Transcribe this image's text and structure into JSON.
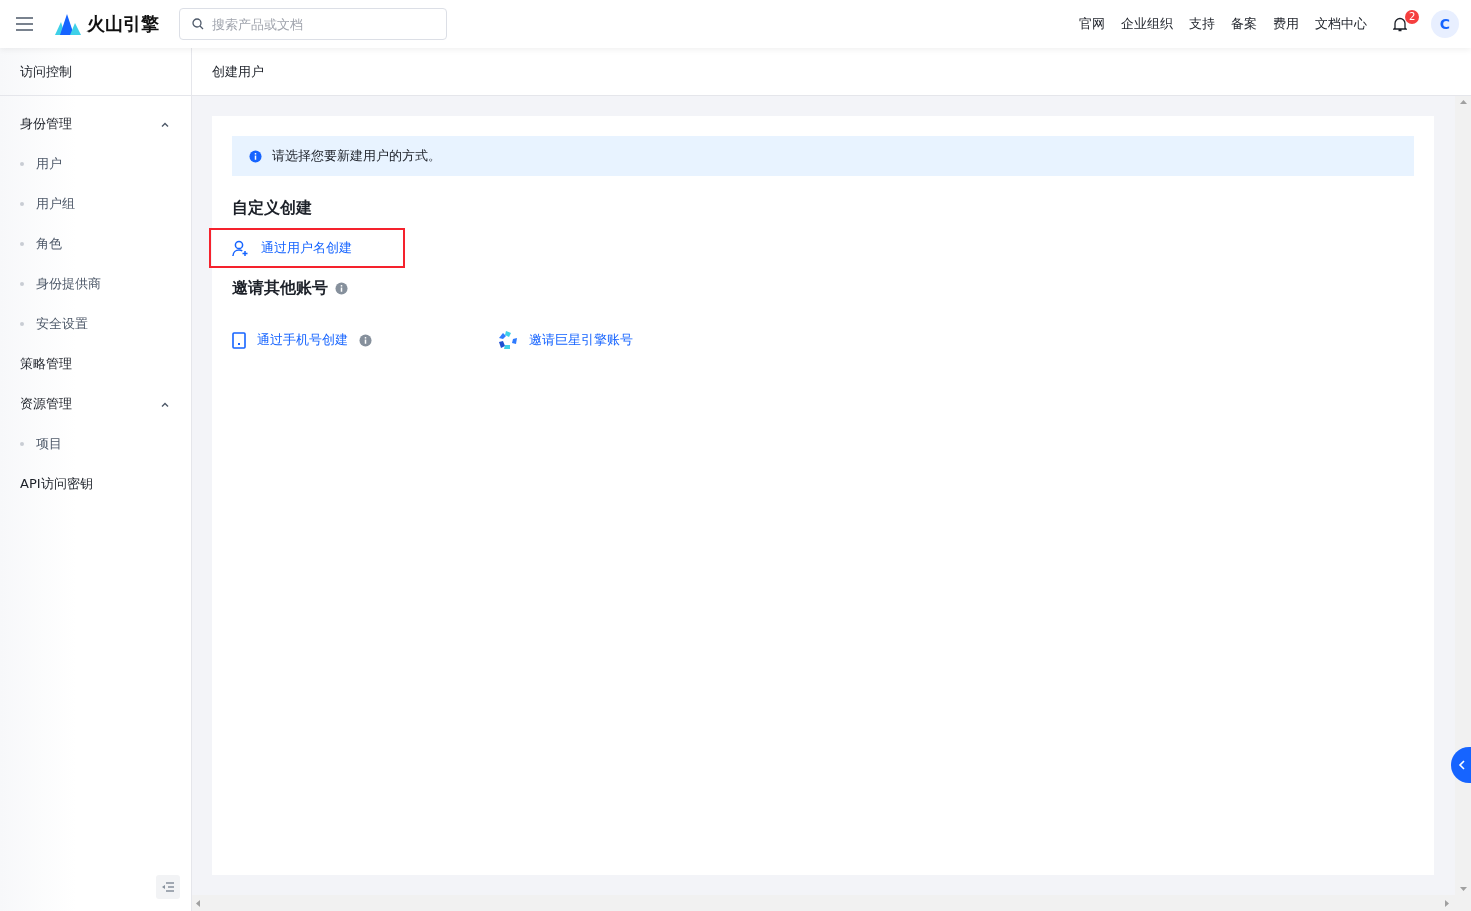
{
  "topbar": {
    "logo_text": "火山引擎",
    "search": {
      "placeholder": "搜索产品或文档"
    },
    "links": [
      "官网",
      "企业组织",
      "支持",
      "备案",
      "费用",
      "文档中心"
    ],
    "notifications": {
      "count": "2"
    },
    "avatar": {
      "initial": "C"
    }
  },
  "sidebar": {
    "title": "访问控制",
    "items": [
      {
        "label": "身份管理",
        "expanded": true,
        "children": [
          {
            "label": "用户"
          },
          {
            "label": "用户组"
          },
          {
            "label": "角色"
          },
          {
            "label": "身份提供商"
          },
          {
            "label": "安全设置"
          }
        ]
      },
      {
        "label": "策略管理"
      },
      {
        "label": "资源管理",
        "expanded": true,
        "children": [
          {
            "label": "项目"
          }
        ]
      },
      {
        "label": "API访问密钥"
      }
    ]
  },
  "breadcrumb": "创建用户",
  "alert": {
    "text": "请选择您要新建用户的方式。"
  },
  "sections": [
    {
      "title": "自定义创建",
      "has_info": false,
      "options": [
        {
          "kind": "username",
          "label": "通过用户名创建",
          "has_info": false,
          "highlighted": true
        }
      ]
    },
    {
      "title": "邀请其他账号",
      "has_info": true,
      "options": [
        {
          "kind": "phone",
          "label": "通过手机号创建",
          "has_info": true,
          "highlighted": false
        },
        {
          "kind": "partner",
          "label": "邀请巨星引擎账号",
          "has_info": false,
          "highlighted": false
        }
      ]
    }
  ]
}
